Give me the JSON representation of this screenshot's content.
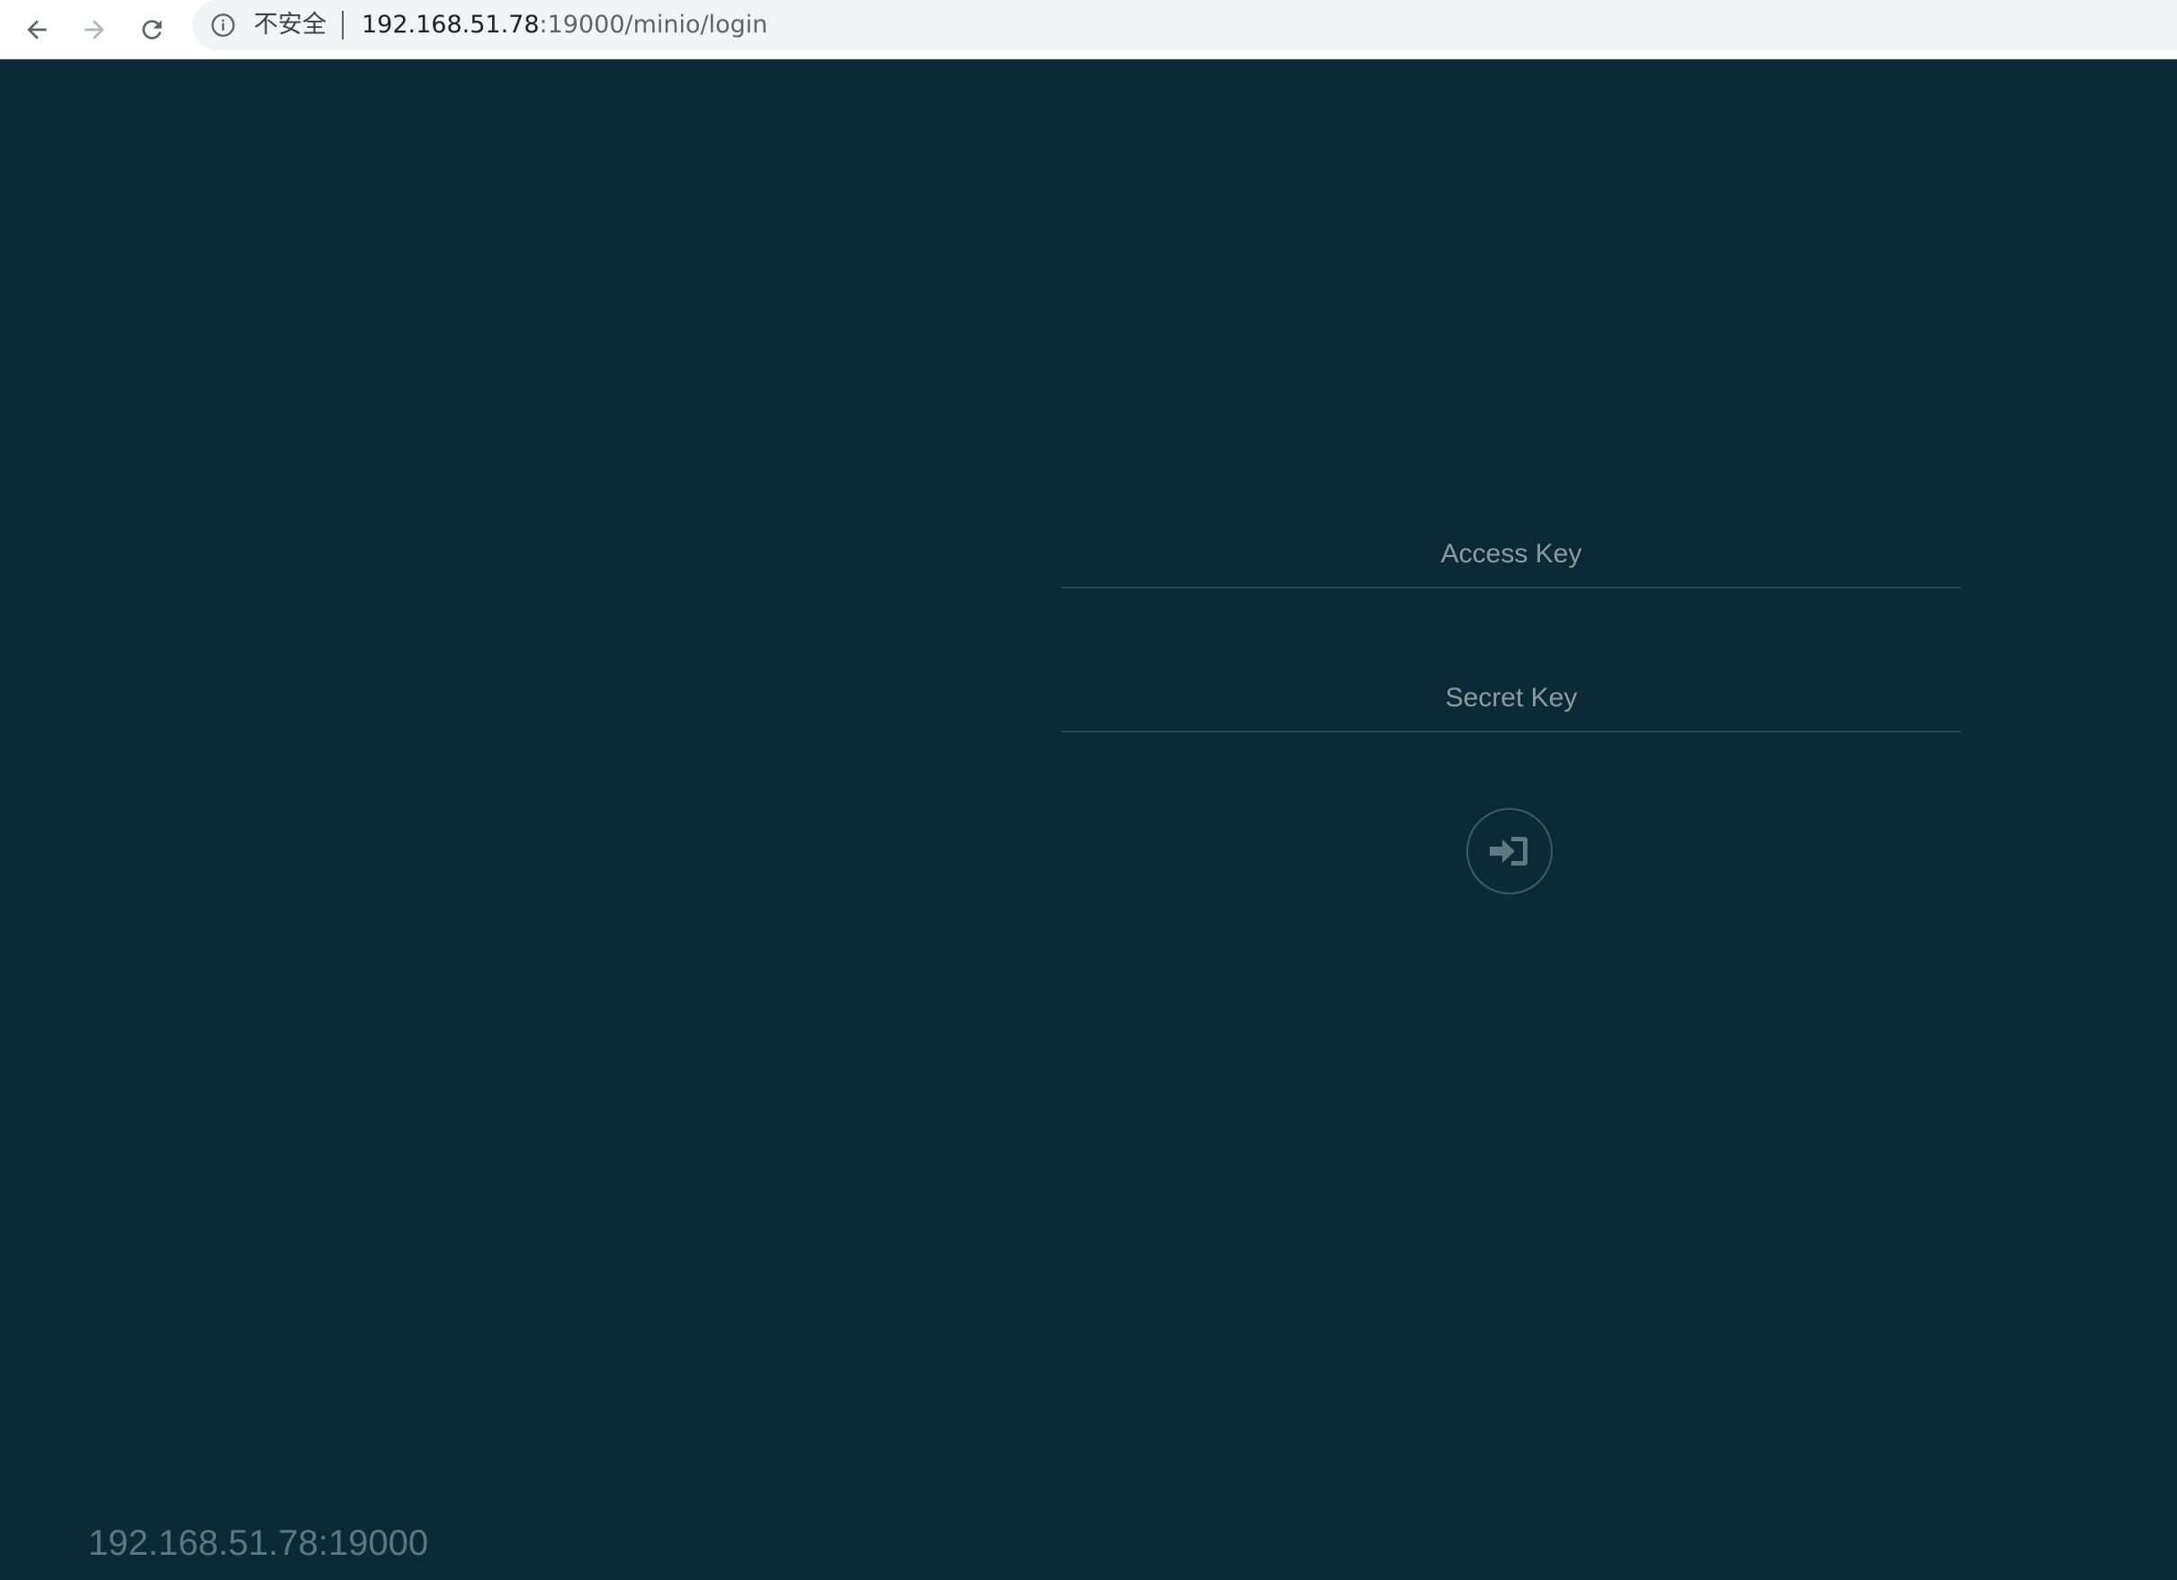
{
  "browser": {
    "security_label": "不安全",
    "url_host": "192.168.51.78",
    "url_path": ":19000/minio/login"
  },
  "login": {
    "access_key_placeholder": "Access Key",
    "secret_key_placeholder": "Secret Key",
    "submit_icon": "sign-in-icon"
  },
  "footer": {
    "host": "192.168.51.78:19000"
  },
  "colors": {
    "background": "#0c2a35",
    "field_line": "#27444f",
    "placeholder": "#8a9ba3",
    "footer_text": "#5c7781"
  }
}
